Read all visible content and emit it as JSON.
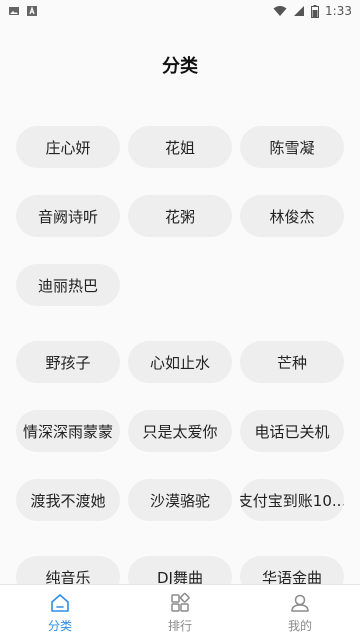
{
  "status_bar": {
    "time": "1:33",
    "icons_left": [
      "image-icon",
      "text-icon"
    ],
    "icons_right": [
      "wifi-icon",
      "signal-icon",
      "battery-icon"
    ]
  },
  "header": {
    "title": "分类"
  },
  "groups": [
    {
      "items": [
        "庄心妍",
        "花姐",
        "陈雪凝",
        "音阙诗听",
        "花粥",
        "林俊杰",
        "迪丽热巴"
      ]
    },
    {
      "items": [
        "野孩子",
        "心如止水",
        "芒种",
        "情深深雨蒙蒙",
        "只是太爱你",
        "电话已关机",
        "渡我不渡她",
        "沙漠骆驼",
        "支付宝到账10..."
      ]
    },
    {
      "items": [
        "纯音乐",
        "DJ舞曲",
        "华语金曲"
      ]
    }
  ],
  "bottom_nav": {
    "items": [
      {
        "label": "分类",
        "icon": "home-icon",
        "active": true
      },
      {
        "label": "排行",
        "icon": "grid-icon",
        "active": false
      },
      {
        "label": "我的",
        "icon": "user-icon",
        "active": false
      }
    ]
  },
  "colors": {
    "accent": "#2f8ee8",
    "chip_bg": "#eeeeee",
    "background": "#fafafa"
  }
}
